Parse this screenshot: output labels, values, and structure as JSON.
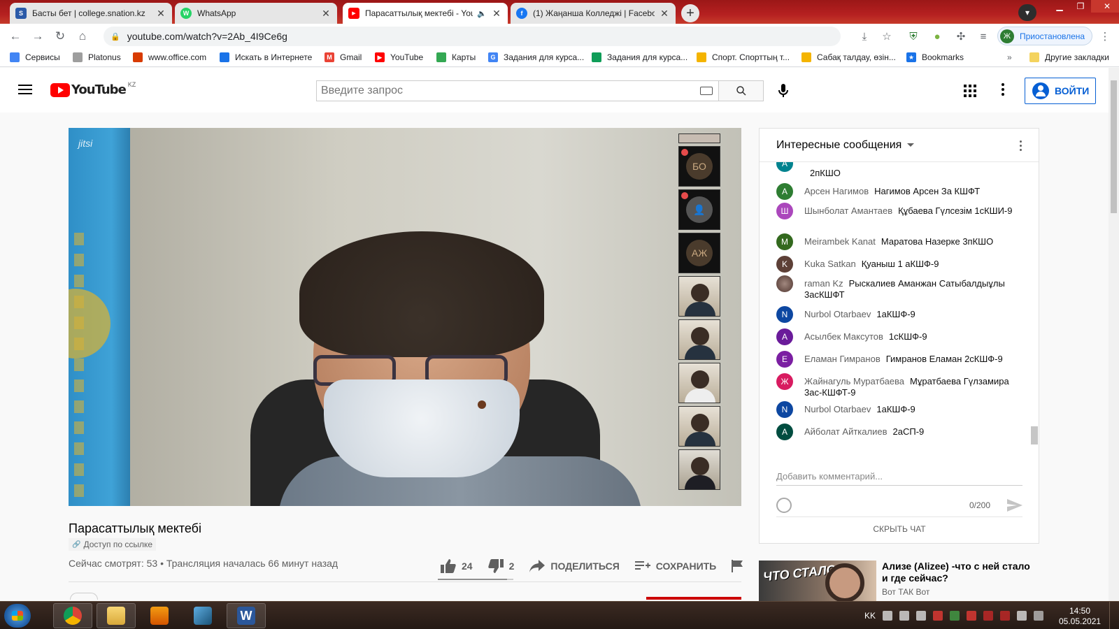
{
  "browser": {
    "tabs": [
      {
        "title": "Басты бет | college.snation.kz",
        "favicon": "S",
        "color": "#2b5aa8"
      },
      {
        "title": "WhatsApp",
        "favicon": "W",
        "color": "#25d366"
      },
      {
        "title": "Парасаттылық мектебі - YouTube",
        "favicon": "▶",
        "color": "#ff0000"
      },
      {
        "title": "(1) Жаңанша Колледжі | Facebook",
        "favicon": "f",
        "color": "#1877f2"
      }
    ],
    "url": "youtube.com/watch?v=2Ab_4I9Ce6g",
    "profile_initial": "Ж",
    "profile_status": "Приостановлена",
    "bookmarks": [
      {
        "label": "Сервисы",
        "color": "#4285f4"
      },
      {
        "label": "Platonus",
        "color": "#9e9e9e"
      },
      {
        "label": "www.office.com",
        "color": "#d83b01"
      },
      {
        "label": "Искать в Интернете",
        "color": "#1a73e8"
      },
      {
        "label": "Gmail",
        "color": "#ea4335"
      },
      {
        "label": "YouTube",
        "color": "#ff0000"
      },
      {
        "label": "Карты",
        "color": "#34a853"
      },
      {
        "label": "Задания для курса...",
        "color": "#4285f4"
      },
      {
        "label": "Задания для курса...",
        "color": "#0f9d58"
      },
      {
        "label": "Спорт. Спорттың т...",
        "color": "#f4b400"
      },
      {
        "label": "Сабақ талдау, өзін...",
        "color": "#f4b400"
      },
      {
        "label": "Bookmarks",
        "color": "#1a73e8"
      }
    ],
    "other_bookmarks": "Другие закладки"
  },
  "youtube": {
    "logo_text": "YouTube",
    "region": "KZ",
    "search_placeholder": "Введите запрос",
    "signin_label": "ВОЙТИ"
  },
  "player": {
    "watermark": "jitsi",
    "participants": [
      "",
      "БО",
      "",
      "АЖ",
      "",
      "",
      "",
      "",
      ""
    ]
  },
  "video": {
    "title": "Парасаттылық мектебі",
    "access": "Доступ по ссылке",
    "viewers": "Сейчас смотрят: 53 • Трансляция началась 66 минут назад",
    "likes": "24",
    "dislikes": "2",
    "like_fraction": 0.92,
    "share_label": "ПОДЕЛИТЬСЯ",
    "save_label": "СОХРАНИТЬ"
  },
  "chat": {
    "header": "Интересные сообщения",
    "messages": [
      {
        "initial": "А",
        "color": "#00838f",
        "author": "",
        "text": "2пКШО"
      },
      {
        "initial": "А",
        "color": "#2e7d32",
        "author": "Арсен Нагимов",
        "text": "Нагимов Арсен За КШФТ"
      },
      {
        "initial": "Ш",
        "color": "#ab47bc",
        "author": "Шынболат Амантаев",
        "text": "Құбаева Гүлсезім 1сКШИ-9"
      },
      {
        "initial": "M",
        "color": "#33691e",
        "author": "Meirambek Kanat",
        "text": "Маратова Назерке 3пКШО"
      },
      {
        "initial": "K",
        "color": "#5d4037",
        "author": "Kuka Satkan",
        "text": "Қуаныш 1 аКШФ-9"
      },
      {
        "initial": "",
        "color": "#6d4c41",
        "author": "raman Kz",
        "text": "Рыскалиев Аманжан Сатыбалдыұлы 3асКШФТ"
      },
      {
        "initial": "N",
        "color": "#0d47a1",
        "author": "Nurbol Otarbaev",
        "text": "1аКШФ-9"
      },
      {
        "initial": "А",
        "color": "#6a1b9a",
        "author": "Асылбек Максутов",
        "text": "1сКШФ-9"
      },
      {
        "initial": "Е",
        "color": "#7b1fa2",
        "author": "Еламан Гимранов",
        "text": "Гимранов Еламан 2сКШФ-9"
      },
      {
        "initial": "Ж",
        "color": "#d81b60",
        "author": "Жайнагуль Муратбаева",
        "text": "Мұратбаева Гүлзамира 3ас-КШФТ-9"
      },
      {
        "initial": "N",
        "color": "#0d47a1",
        "author": "Nurbol Otarbaev",
        "text": "1аКШФ-9"
      },
      {
        "initial": "А",
        "color": "#004d40",
        "author": "Айболат Айткалиев",
        "text": "2аСП-9"
      }
    ],
    "input_placeholder": "Добавить комментарий...",
    "counter": "0/200",
    "hide_label": "СКРЫТЬ ЧАТ"
  },
  "recommended": {
    "thumb_text": "ЧТО СТАЛО",
    "title": "Ализе (Alizee) -что с ней стало и где сейчас?",
    "channel": "Вот ТАК Вот"
  },
  "taskbar": {
    "language": "KK",
    "time": "14:50",
    "date": "05.05.2021"
  }
}
